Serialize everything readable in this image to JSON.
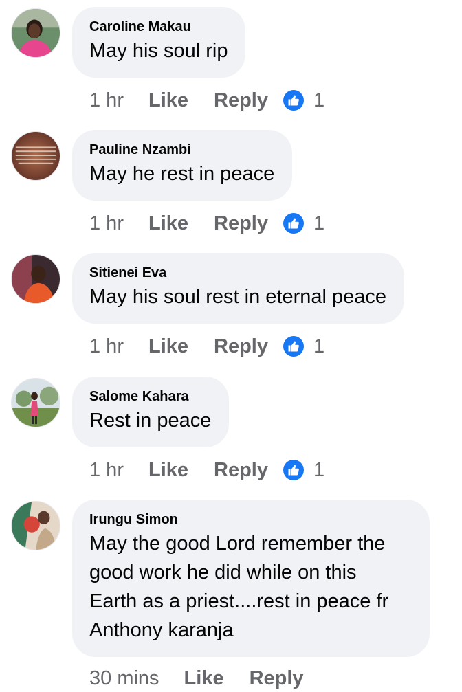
{
  "comments": [
    {
      "author": "Caroline Makau",
      "text": "May his soul rip",
      "time": "1 hr",
      "like_label": "Like",
      "reply_label": "Reply",
      "reaction_count": "1"
    },
    {
      "author": "Pauline Nzambi",
      "text": "May he rest in peace",
      "time": "1 hr",
      "like_label": "Like",
      "reply_label": "Reply",
      "reaction_count": "1"
    },
    {
      "author": "Sitienei Eva",
      "text": "May his soul rest in eternal peace",
      "time": "1 hr",
      "like_label": "Like",
      "reply_label": "Reply",
      "reaction_count": "1"
    },
    {
      "author": "Salome Kahara",
      "text": "Rest in peace",
      "time": "1 hr",
      "like_label": "Like",
      "reply_label": "Reply",
      "reaction_count": "1"
    },
    {
      "author": "Irungu Simon",
      "text_lines": [
        "May the good Lord remember the",
        "good work he did while on this",
        "Earth as a priest....rest in peace fr",
        "Anthony karanja"
      ],
      "time": "30 mins",
      "like_label": "Like",
      "reply_label": "Reply"
    }
  ],
  "colors": {
    "bubble": "#f0f2f5",
    "meta_text": "#65676b",
    "like_badge": "#1877f2"
  },
  "icons": {
    "reaction": "thumbs-up-icon"
  }
}
